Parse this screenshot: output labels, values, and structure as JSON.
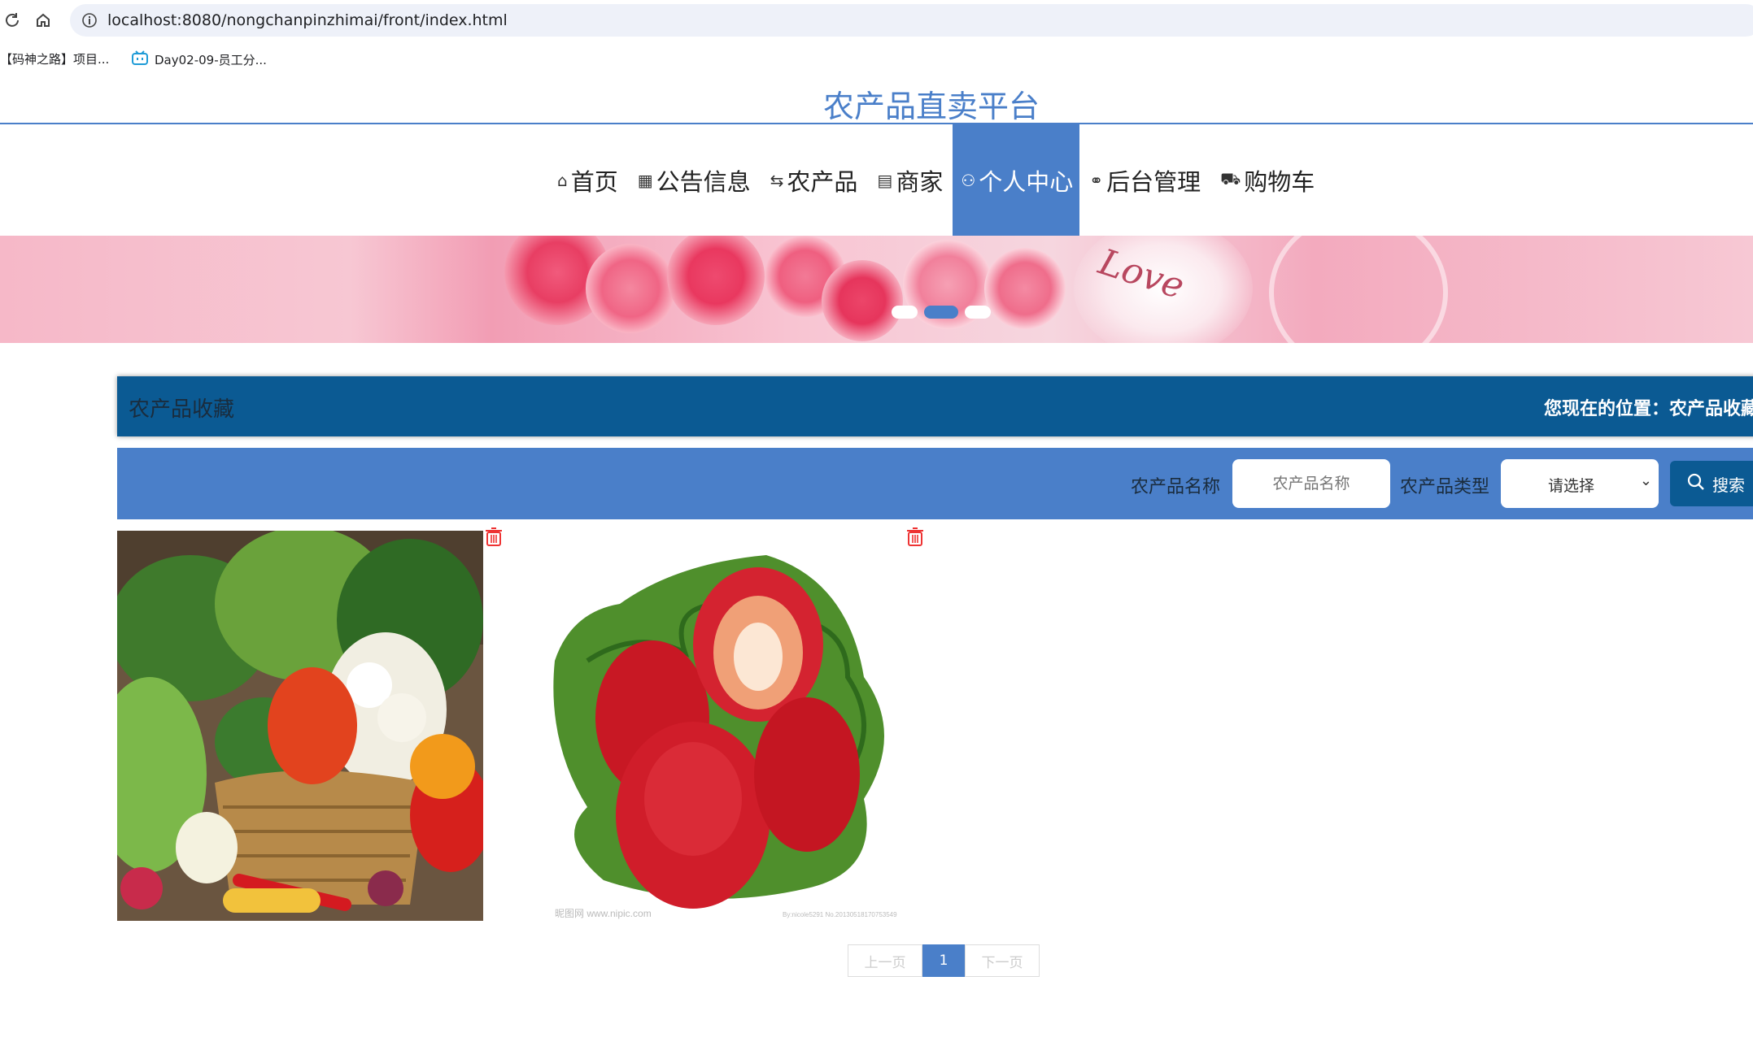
{
  "browser": {
    "url": "localhost:8080/nongchanpinzhimai/front/index.html",
    "bookmarks": [
      "【码神之路】项目...",
      "Day02-09-员工分..."
    ]
  },
  "site": {
    "title": "农产品直卖平台"
  },
  "nav": [
    {
      "label": "首页",
      "icon": "home-icon",
      "glyph": "⌂"
    },
    {
      "label": "公告信息",
      "icon": "grid-icon",
      "glyph": "▦"
    },
    {
      "label": "农产品",
      "icon": "swap-icon",
      "glyph": "⇆"
    },
    {
      "label": "商家",
      "icon": "clipboard-icon",
      "glyph": "▤"
    },
    {
      "label": "个人中心",
      "icon": "user-icon",
      "glyph": "⚇",
      "active": true
    },
    {
      "label": "后台管理",
      "icon": "link-icon",
      "glyph": "⚭"
    },
    {
      "label": "购物车",
      "icon": "cart-icon",
      "glyph": "⛟"
    }
  ],
  "banner": {
    "slides": 3,
    "active_slide": 2,
    "text": "Love"
  },
  "section": {
    "title": "农产品收藏",
    "breadcrumb": "您现在的位置：农产品收藏"
  },
  "filter": {
    "name_label": "农产品名称",
    "name_placeholder": "农产品名称",
    "type_label": "农产品类型",
    "type_selected": "请选择",
    "search_label": "搜索"
  },
  "items": [
    {
      "name": "vegetable-basket-image",
      "watermark": ""
    },
    {
      "name": "strawberry-image",
      "watermark_left": "昵图网 www.nipic.com",
      "watermark_right": "By:nicole5291 No.20130518170753549"
    }
  ],
  "pagination": {
    "prev": "上一页",
    "current": "1",
    "next": "下一页"
  },
  "colors": {
    "accent": "#4a7fc9",
    "header_dark": "#0b5a93"
  }
}
